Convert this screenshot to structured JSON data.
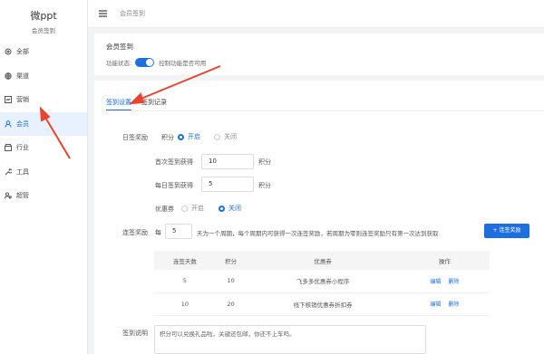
{
  "sidebar": {
    "brand": "微ppt",
    "subtitle": "会员签到",
    "items": [
      {
        "label": "全部",
        "icon": "settings-icon"
      },
      {
        "label": "渠道",
        "icon": "globe-icon"
      },
      {
        "label": "营销",
        "icon": "chart-icon"
      },
      {
        "label": "会员",
        "icon": "user-icon"
      },
      {
        "label": "行业",
        "icon": "store-icon"
      },
      {
        "label": "工具",
        "icon": "wrench-icon"
      },
      {
        "label": "超管",
        "icon": "admin-icon"
      }
    ],
    "active_index": 3
  },
  "topbar": {
    "breadcrumb": "会员签到"
  },
  "member_card": {
    "title": "会员签到",
    "status_label": "功能状态:",
    "status_hint": "控制功能是否可用",
    "enabled": true
  },
  "tabs": [
    "签到设置",
    "签到记录"
  ],
  "settings": {
    "daily_reward_label": "日签奖励",
    "points_label": "积分",
    "on_label": "开启",
    "off_label": "关闭",
    "first_sign_label": "首次签到获得",
    "first_sign_value": "10",
    "daily_sign_label": "每日签到获得",
    "daily_sign_value": "5",
    "points_unit": "积分",
    "coupon_label": "优惠券",
    "streak_label": "连签奖励",
    "streak_prefix": "每",
    "streak_value": "5",
    "streak_desc": "天为一个周期，每个周期内可获得一次连签奖励，若周期为零则连签奖励只有第一次达到获取",
    "add_button": "+ 连签奖励"
  },
  "table": {
    "headers": [
      "连签天数",
      "积分",
      "优惠券",
      "操作"
    ],
    "rows": [
      [
        "5",
        "10",
        "飞多多优惠券小程序"
      ],
      [
        "10",
        "20",
        "线下核销优惠券折扣券"
      ]
    ],
    "edit_label": "编辑",
    "delete_label": "删除"
  },
  "description": {
    "label": "签到说明",
    "text": "积分可以兑换礼品啦，关键还包邮，你还不上车吗。"
  },
  "colors": {
    "accent": "#1d6fe0",
    "arrow": "#e8442e"
  }
}
